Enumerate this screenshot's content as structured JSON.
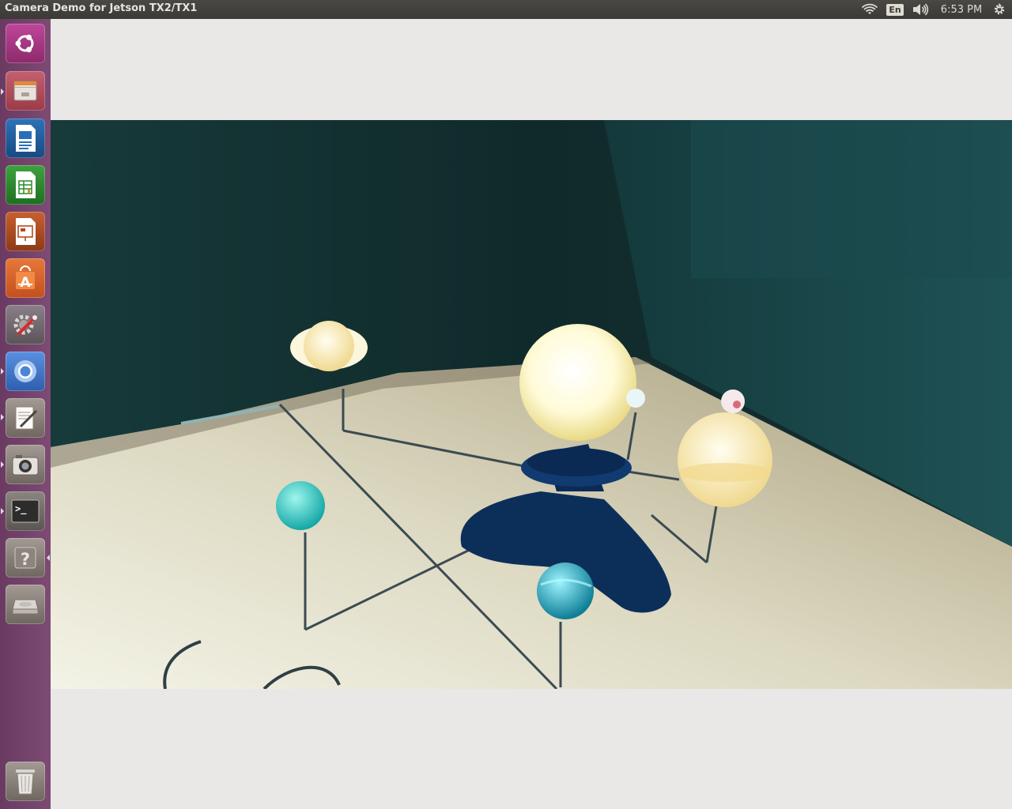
{
  "window": {
    "title": "Camera Demo for Jetson TX2/TX1"
  },
  "panel": {
    "language": "En",
    "time": "6:53 PM",
    "icons": [
      "wifi-icon",
      "keyboard-language-indicator",
      "volume-icon",
      "session-gear-icon"
    ]
  },
  "launcher": {
    "items": [
      {
        "name": "ubuntu-dash-icon",
        "color": "#a7357f"
      },
      {
        "name": "files-icon",
        "color": "#b14a56"
      },
      {
        "name": "libreoffice-writer-icon",
        "color": "#1e5c9c"
      },
      {
        "name": "libreoffice-calc-icon",
        "color": "#2d8a2f"
      },
      {
        "name": "libreoffice-impress-icon",
        "color": "#b54a1e"
      },
      {
        "name": "software-center-icon",
        "color": "#d9622b"
      },
      {
        "name": "system-settings-icon",
        "color": "#7d6f79"
      },
      {
        "name": "chromium-icon",
        "color": "#3a73c8"
      },
      {
        "name": "text-editor-icon",
        "color": "#8a8178"
      },
      {
        "name": "camera-app-icon",
        "color": "#8a8178"
      },
      {
        "name": "terminal-icon",
        "color": "#6e6a66"
      },
      {
        "name": "help-icon",
        "color": "#8a8178"
      },
      {
        "name": "disk-drive-icon",
        "color": "#8a8178"
      },
      {
        "name": "trash-icon",
        "color": "#8a8178"
      }
    ]
  },
  "colors": {
    "panel": "#3b3a36",
    "launcher": "#7d4b74",
    "window_bg": "#e9e8e6"
  }
}
